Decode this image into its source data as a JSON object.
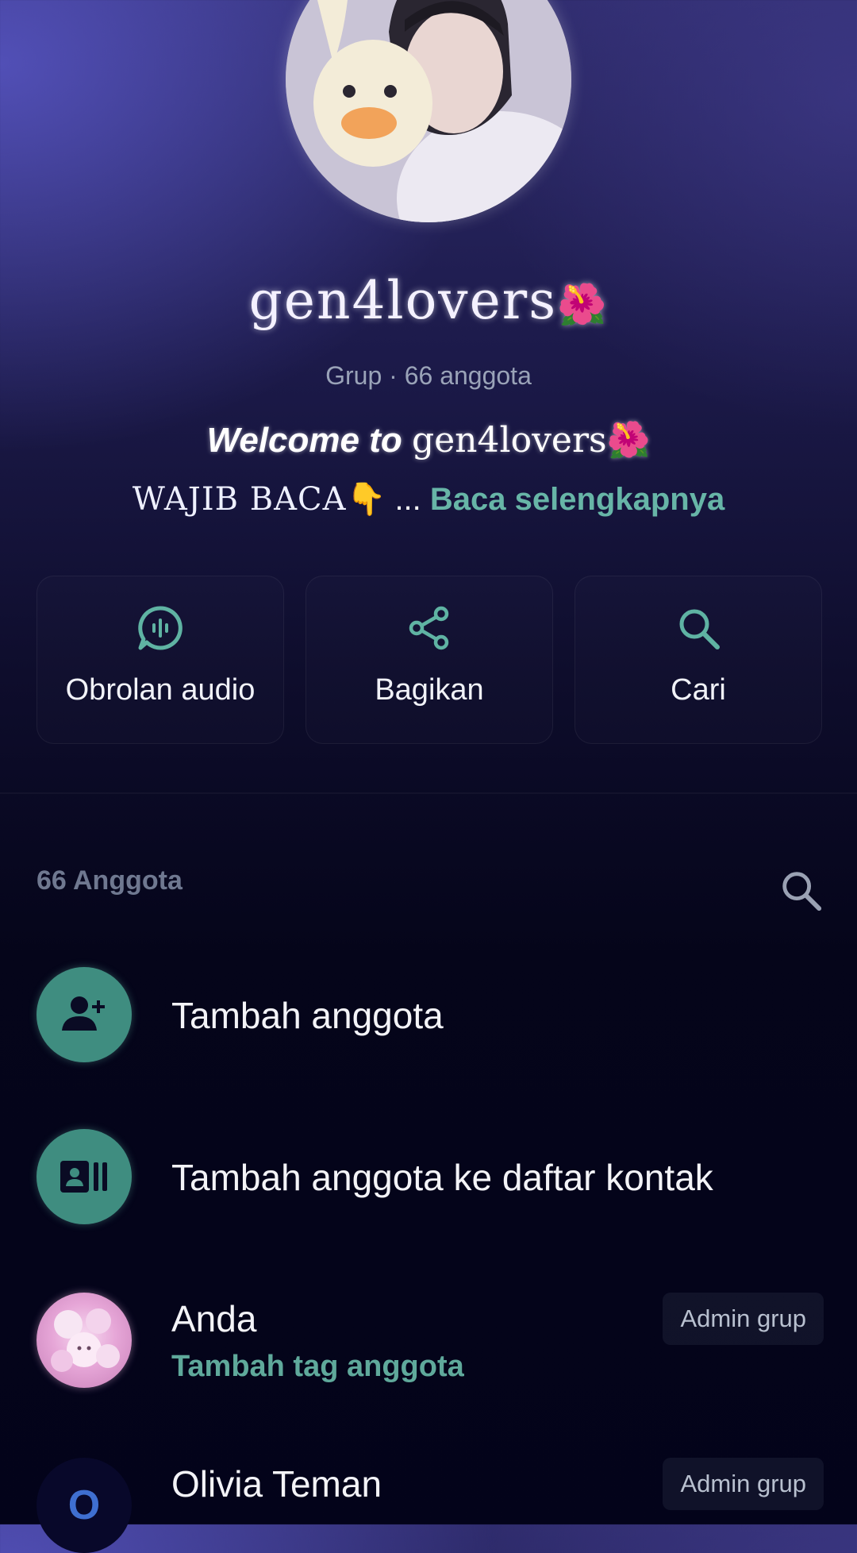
{
  "header": {
    "group_name": "gen4lovers",
    "group_name_emoji": "🌺",
    "meta": "Grup · 66 anggota",
    "welcome_lead": "Welcome to",
    "welcome_name": "gen4lovers",
    "welcome_emoji": "🌺",
    "description_text": "WAJIB BACA",
    "description_emoji": "👇",
    "description_ellipsis": " ...",
    "read_more": "Baca selengkapnya"
  },
  "actions": [
    {
      "label": "Obrolan audio",
      "icon": "audio-chat-icon"
    },
    {
      "label": "Bagikan",
      "icon": "share-icon"
    },
    {
      "label": "Cari",
      "icon": "search-icon"
    }
  ],
  "members": {
    "header": "66 Anggota",
    "add_member": "Tambah anggota",
    "add_to_contacts": "Tambah anggota ke daftar kontak",
    "list": [
      {
        "name": "Anda",
        "subtitle": "Tambah tag anggota",
        "badge": "Admin grup"
      },
      {
        "name": "Olivia Teman",
        "initial": "O",
        "badge": "Admin grup"
      }
    ]
  },
  "colors": {
    "accent": "#3f8d80",
    "accent_text": "#67b5a7",
    "bg_top": "#2f2c6d",
    "bg_bottom": "#03031a"
  }
}
